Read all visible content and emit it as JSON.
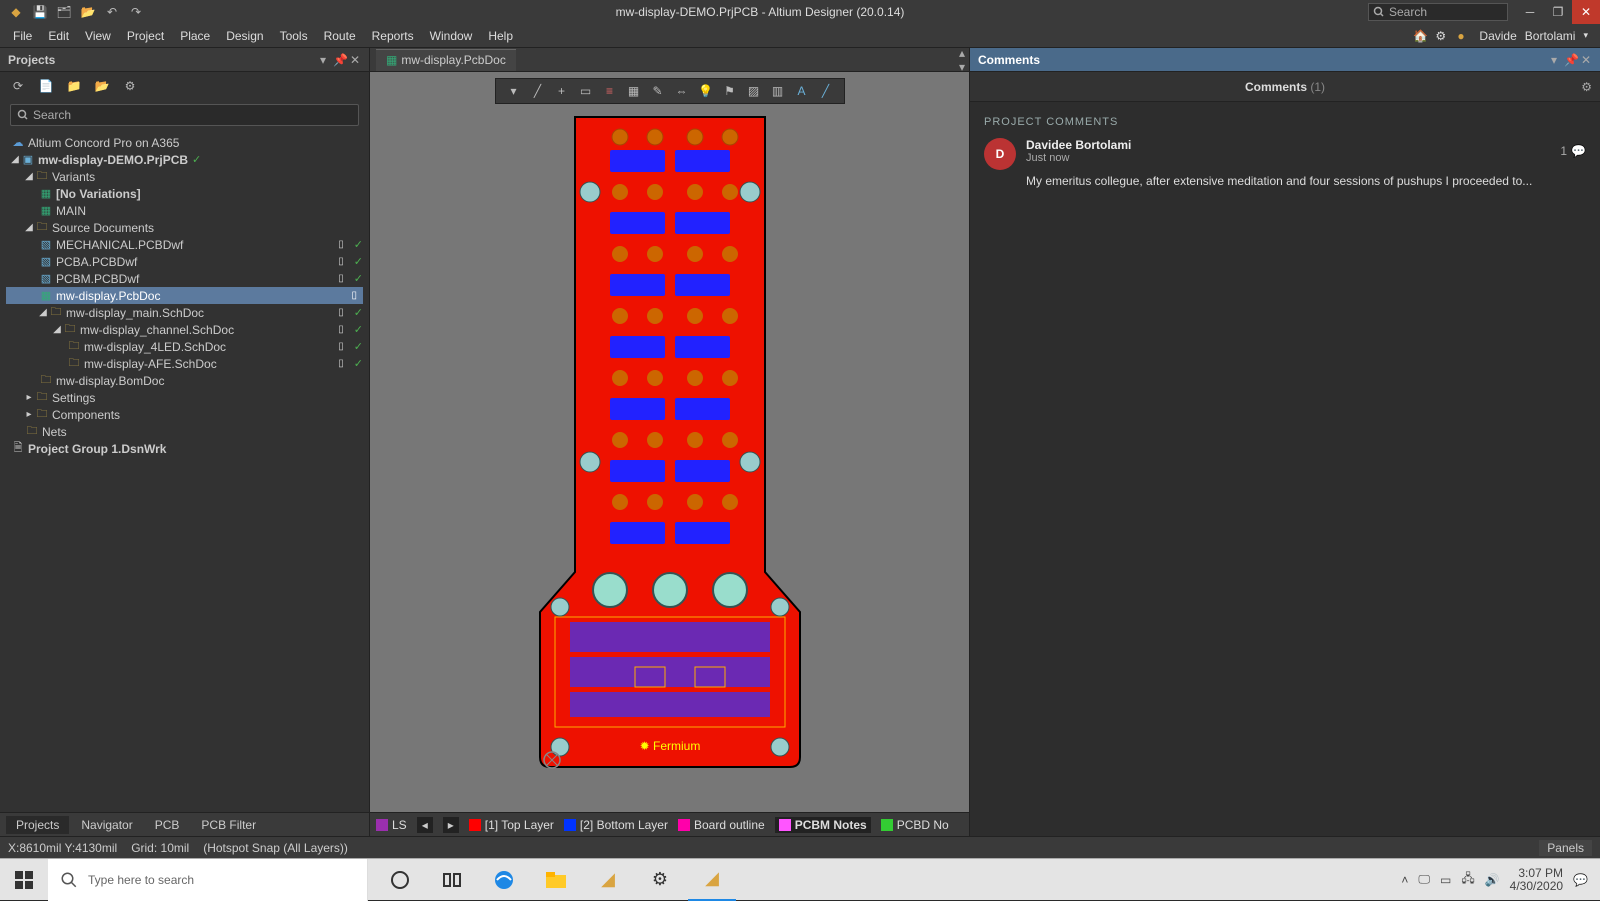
{
  "app": {
    "title": "mw-display-DEMO.PrjPCB - Altium Designer (20.0.14)",
    "search_placeholder": "Search"
  },
  "menus": [
    "File",
    "Edit",
    "View",
    "Project",
    "Place",
    "Design",
    "Tools",
    "Route",
    "Reports",
    "Window",
    "Help"
  ],
  "user": {
    "name": "Davide",
    "surname": "Bortolami"
  },
  "panel": {
    "title": "Projects",
    "search_placeholder": "Search",
    "root_cloud": "Altium Concord Pro on A365",
    "project": "mw-display-DEMO.PrjPCB",
    "variants_label": "Variants",
    "no_variations": "[No Variations]",
    "main_label": "MAIN",
    "src_docs": "Source Documents",
    "files": {
      "mech": "MECHANICAL.PCBDwf",
      "pcba": "PCBA.PCBDwf",
      "pcbm": "PCBM.PCBDwf",
      "pcbdoc": "mw-display.PcbDoc",
      "mainsch": "mw-display_main.SchDoc",
      "chsch": "mw-display_channel.SchDoc",
      "ledsch": "mw-display_4LED.SchDoc",
      "afesch": "mw-display-AFE.SchDoc",
      "bom": "mw-display.BomDoc"
    },
    "settings": "Settings",
    "components": "Components",
    "nets": "Nets",
    "group": "Project Group 1.DsnWrk"
  },
  "open_tab": "mw-display.PcbDoc",
  "bottom_tabs": [
    "Projects",
    "Navigator",
    "PCB",
    "PCB Filter"
  ],
  "layer_strip": {
    "ls": "LS",
    "layers": [
      {
        "color": "#9b2fae",
        "label": ""
      },
      {
        "color": "#ff0000",
        "label": "[1] Top Layer"
      },
      {
        "color": "#0033ff",
        "label": "[2] Bottom Layer"
      },
      {
        "color": "#ff00aa",
        "label": "Board outline"
      },
      {
        "color": "#ff55ff",
        "label": "PCBM Notes",
        "bold": true
      },
      {
        "color": "#33cc33",
        "label": "PCBD No"
      }
    ]
  },
  "status": {
    "coords": "X:8610mil Y:4130mil",
    "grid": "Grid: 10mil",
    "snap": "(Hotspot Snap (All Layers))",
    "panels": "Panels"
  },
  "comments": {
    "panel_title": "Comments",
    "header": "Comments",
    "count": "(1)",
    "section": "PROJECT COMMENTS",
    "item": {
      "initial": "D",
      "author": "Davidee Bortolami",
      "time": "Just now",
      "msg": "My emeritus collegue, after extensive meditation and four sessions of pushups I proceeded to...",
      "replies": "1"
    }
  },
  "taskbar": {
    "search_placeholder": "Type here to search",
    "time": "3:07 PM",
    "date": "4/30/2020"
  }
}
